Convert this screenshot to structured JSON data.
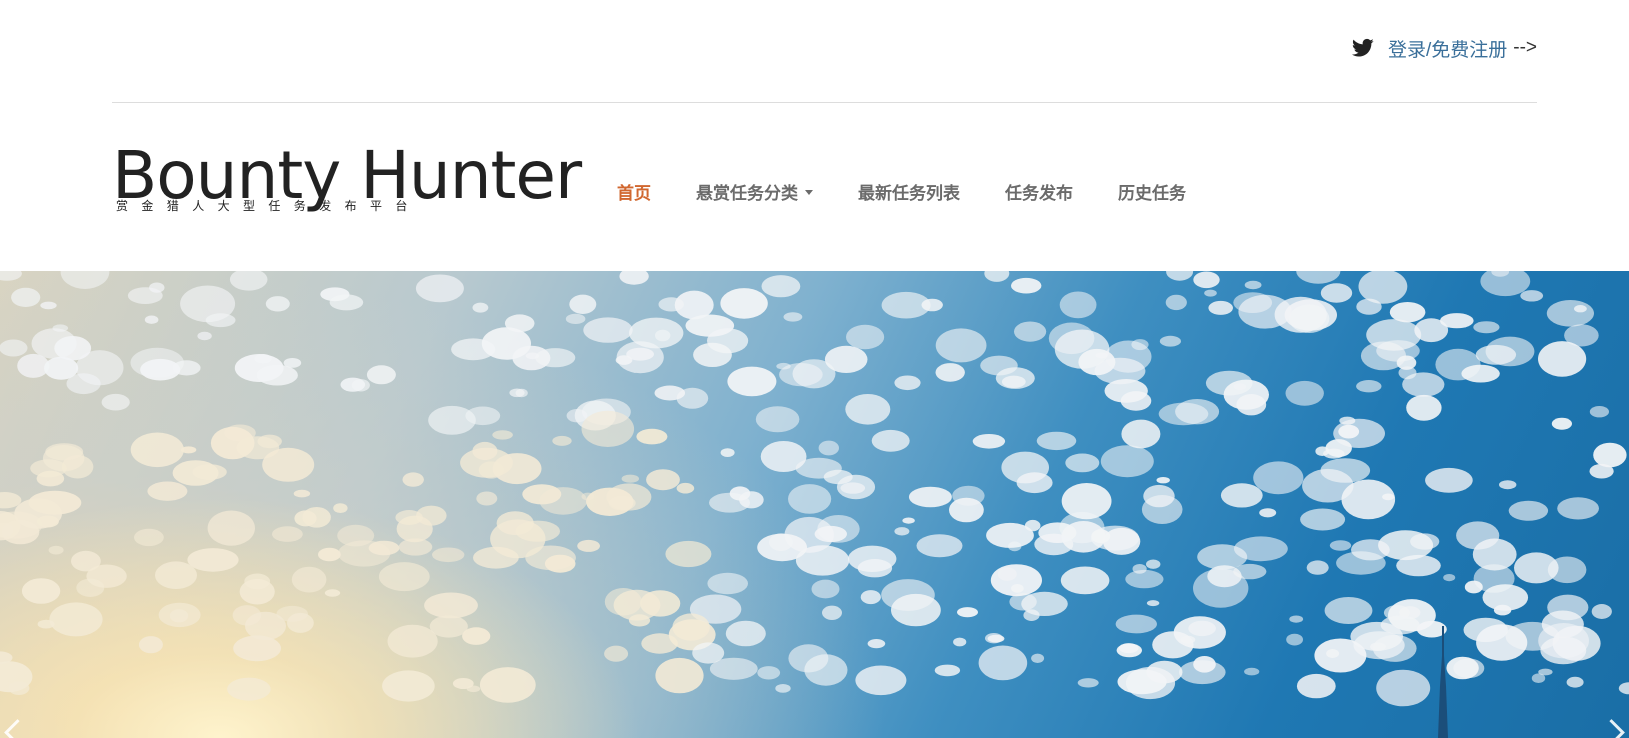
{
  "topbar": {
    "social_icon": "twitter-icon",
    "login_link": "登录/免费注册",
    "trailing_text": "-->"
  },
  "logo": {
    "title": "Bounty Hunter",
    "subtitle": "赏金猎人大型任务发布平台"
  },
  "nav": {
    "items": [
      {
        "label": "首页",
        "active": true
      },
      {
        "label": "悬赏任务分类",
        "dropdown": true
      },
      {
        "label": "最新任务列表"
      },
      {
        "label": "任务发布"
      },
      {
        "label": "历史任务"
      }
    ]
  },
  "hero": {
    "image": "sky-with-clouds-and-tower-banner",
    "prev_icon": "chevron-left-icon",
    "next_icon": "chevron-right-icon"
  },
  "colors": {
    "link": "#3a6f9a",
    "nav_active": "#d1672f",
    "nav_default": "#6b6b6b",
    "logo_text": "#222222"
  }
}
